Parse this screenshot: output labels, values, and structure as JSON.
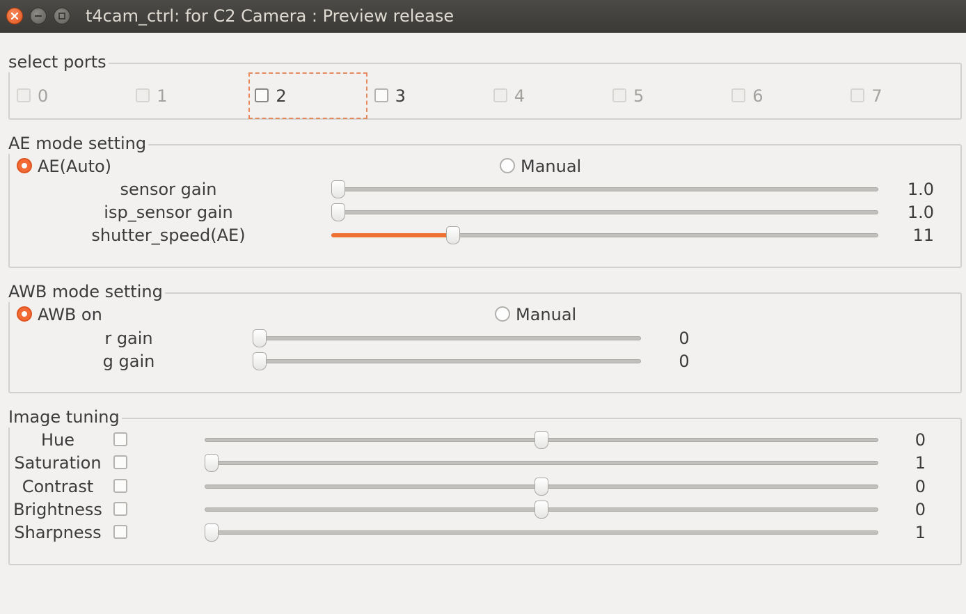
{
  "window": {
    "title": "t4cam_ctrl: for C2 Camera : Preview release"
  },
  "ports": {
    "title": "select ports",
    "items": [
      {
        "label": "0",
        "enabled": false,
        "checked": false
      },
      {
        "label": "1",
        "enabled": false,
        "checked": false
      },
      {
        "label": "2",
        "enabled": true,
        "checked": false,
        "focused": true
      },
      {
        "label": "3",
        "enabled": true,
        "checked": false
      },
      {
        "label": "4",
        "enabled": false,
        "checked": false
      },
      {
        "label": "5",
        "enabled": false,
        "checked": false
      },
      {
        "label": "6",
        "enabled": false,
        "checked": false
      },
      {
        "label": "7",
        "enabled": false,
        "checked": false
      }
    ]
  },
  "ae": {
    "title": "AE mode setting",
    "auto_label": "AE(Auto)",
    "manual_label": "Manual",
    "mode": "auto",
    "sliders": [
      {
        "label": "sensor gain",
        "value_text": "1.0",
        "fraction": 0.0
      },
      {
        "label": "isp_sensor gain",
        "value_text": "1.0",
        "fraction": 0.0
      },
      {
        "label": "shutter_speed(AE)",
        "value_text": "11",
        "fraction": 0.215
      }
    ]
  },
  "awb": {
    "title": "AWB mode setting",
    "auto_label": "AWB on",
    "manual_label": "Manual",
    "mode": "auto",
    "sliders": [
      {
        "label": "r gain",
        "value_text": "0",
        "fraction": 0.0
      },
      {
        "label": "g gain",
        "value_text": "0",
        "fraction": 0.0
      }
    ]
  },
  "tuning": {
    "title": "Image tuning",
    "items": [
      {
        "label": "Hue",
        "value_text": "0",
        "fraction": 0.5,
        "checked": false
      },
      {
        "label": "Saturation",
        "value_text": "1",
        "fraction": 0.0,
        "checked": false
      },
      {
        "label": "Contrast",
        "value_text": "0",
        "fraction": 0.5,
        "checked": false
      },
      {
        "label": "Brightness",
        "value_text": "0",
        "fraction": 0.5,
        "checked": false
      },
      {
        "label": "Sharpness",
        "value_text": "1",
        "fraction": 0.0,
        "checked": false
      }
    ]
  },
  "colors": {
    "accent": "#f26b34",
    "titlebar": "#3c3b37",
    "background": "#f2f1f0"
  }
}
